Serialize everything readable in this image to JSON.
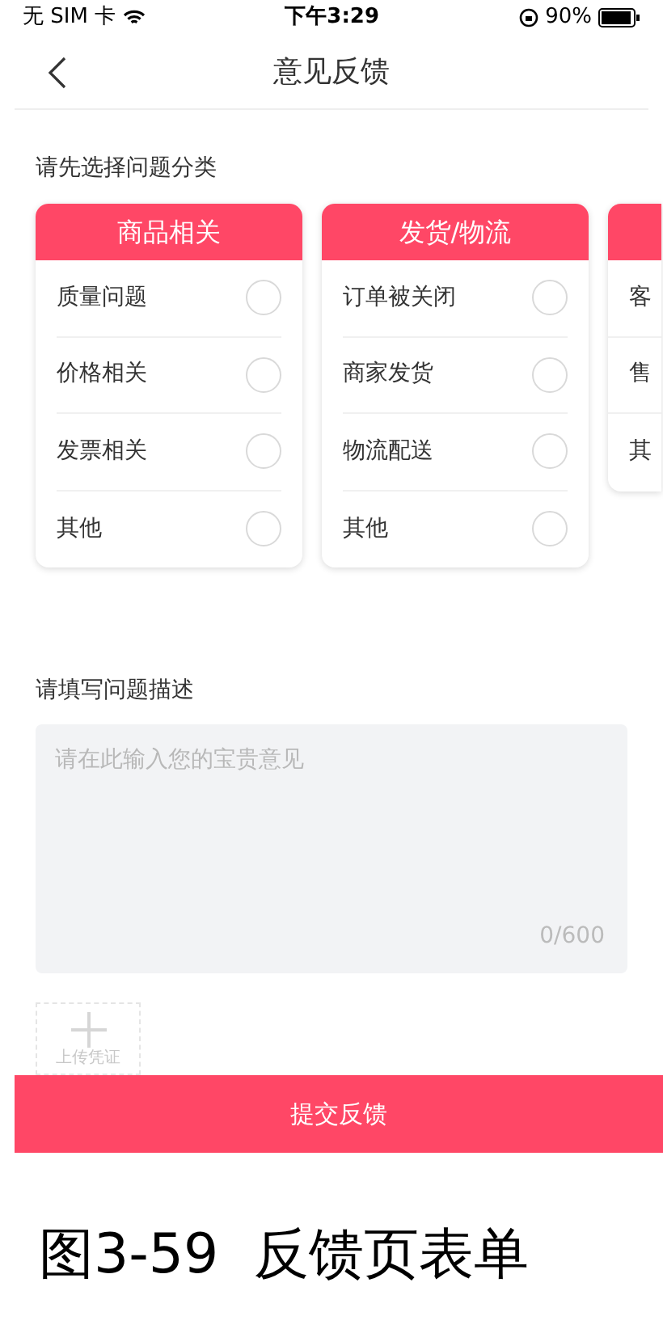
{
  "status_bar": {
    "carrier": "无 SIM 卡",
    "time": "下午3:29",
    "battery": "90%"
  },
  "nav": {
    "title": "意见反馈"
  },
  "category_label": "请先选择问题分类",
  "categories": [
    {
      "title": "商品相关",
      "options": [
        {
          "label": "质量问题",
          "selected": false
        },
        {
          "label": "价格相关",
          "selected": false
        },
        {
          "label": "发票相关",
          "selected": false
        },
        {
          "label": "其他",
          "selected": false
        }
      ]
    },
    {
      "title": "发货/物流",
      "options": [
        {
          "label": "订单被关闭",
          "selected": false
        },
        {
          "label": "商家发货",
          "selected": false
        },
        {
          "label": "物流配送",
          "selected": false
        },
        {
          "label": "其他",
          "selected": false
        }
      ]
    },
    {
      "options": [
        {
          "label": "客"
        },
        {
          "label": "售"
        },
        {
          "label": "其"
        }
      ]
    }
  ],
  "description_label": "请填写问题描述",
  "description": {
    "placeholder": "请在此输入您的宝贵意见",
    "counter": "0/600"
  },
  "upload": {
    "label": "上传凭证"
  },
  "submit": "提交反馈",
  "caption": "图3-59  反馈页表单"
}
